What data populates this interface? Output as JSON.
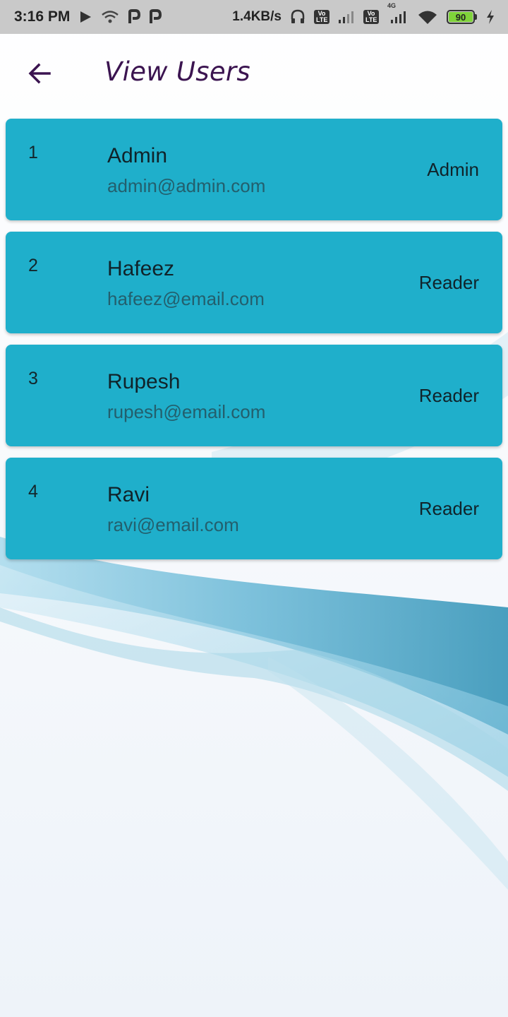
{
  "status_bar": {
    "time": "3:16 PM",
    "net_speed": "1.4KB/s",
    "battery_level": "90",
    "signal_label": "4G",
    "volte_label_1": "Vo",
    "volte_label_2": "LTE",
    "icons": [
      "play-icon",
      "wifi-icon",
      "p-app-icon",
      "p-app-icon",
      "headset-icon",
      "volte-icon",
      "signal-icon",
      "wifi-icon",
      "battery-icon",
      "charging-icon"
    ]
  },
  "app_bar": {
    "title": "View Users",
    "back_icon": "arrow-left-icon"
  },
  "users": [
    {
      "index": "1",
      "name": "Admin",
      "email": "admin@admin.com",
      "role": "Admin"
    },
    {
      "index": "2",
      "name": "Hafeez",
      "email": "hafeez@email.com",
      "role": "Reader"
    },
    {
      "index": "3",
      "name": "Rupesh",
      "email": "rupesh@email.com",
      "role": "Reader"
    },
    {
      "index": "4",
      "name": "Ravi",
      "email": "ravi@email.com",
      "role": "Reader"
    }
  ],
  "colors": {
    "card_background": "#1fafcb",
    "title_color": "#3b1450",
    "status_bar": "#c9c9c9",
    "battery_fill": "#7fd33a"
  }
}
